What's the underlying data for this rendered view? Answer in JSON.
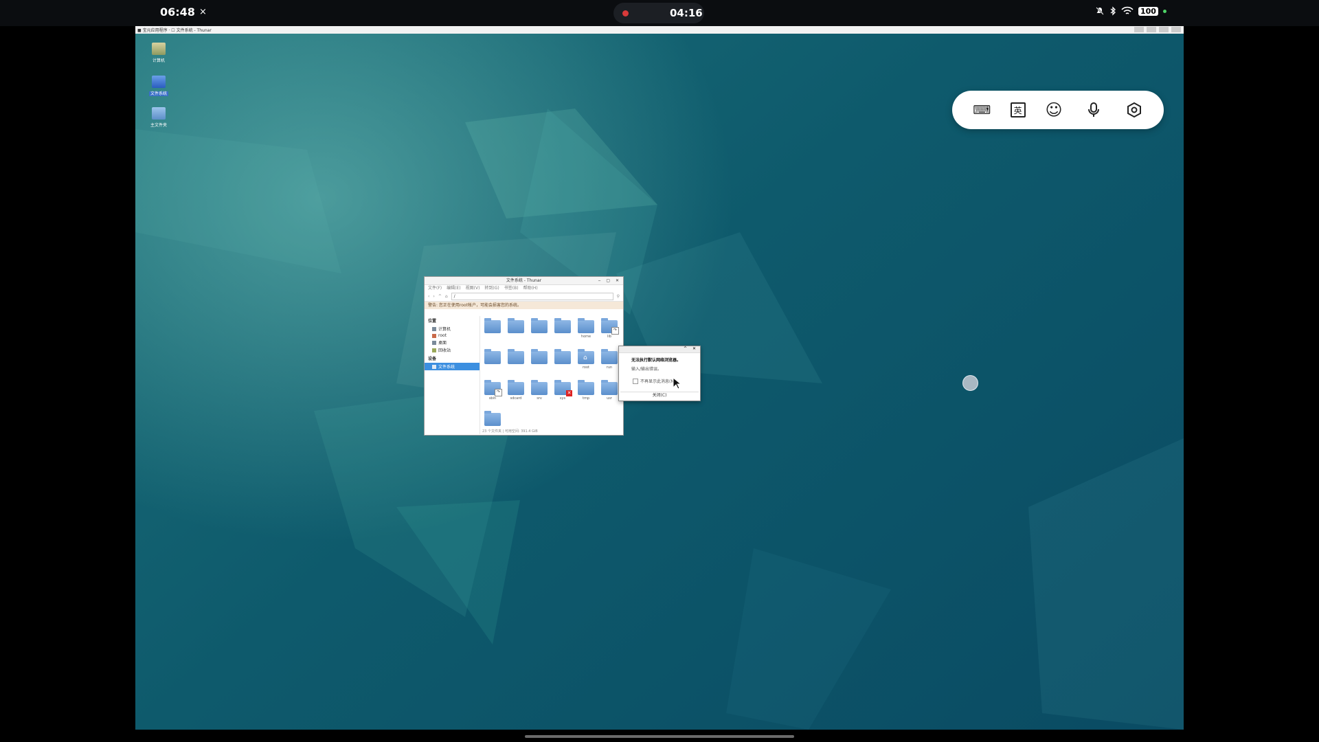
{
  "status_bar": {
    "time": "06:48",
    "close_glyph": "×",
    "recording_time": "04:16",
    "battery": "100",
    "icons": [
      "bell-muted-icon",
      "bluetooth-icon",
      "wifi-icon"
    ]
  },
  "remote_topbar": {
    "title": "■ 宝元应用程序 · ☐ 文件系统 - Thunar"
  },
  "desktop_icons": [
    {
      "label": "计算机",
      "icon": "computer-icon"
    },
    {
      "label": "文件系统",
      "icon": "drive-icon"
    },
    {
      "label": "主文件夹",
      "icon": "home-folder-icon"
    }
  ],
  "ime_toolbar": {
    "buttons": [
      {
        "name": "keyboard-icon",
        "glyph": "⌨"
      },
      {
        "name": "language-icon",
        "glyph": "英"
      },
      {
        "name": "emoji-icon",
        "glyph": "☺"
      },
      {
        "name": "microphone-icon",
        "glyph": "🎙"
      },
      {
        "name": "settings-icon",
        "glyph": "⬡"
      }
    ]
  },
  "file_manager": {
    "title": "文件系统 - Thunar",
    "window_controls": "‒ ▢ ✕",
    "menu": [
      "文件(F)",
      "编辑(E)",
      "视图(V)",
      "转到(G)",
      "书签(B)",
      "帮助(H)"
    ],
    "path": "/",
    "warning": "警告: 您正在使用root帐户，可能会损害您的系统。",
    "sidebar": {
      "places_header": "位置",
      "places": [
        "计算机",
        "root",
        "桌面",
        "回收站"
      ],
      "devices_header": "设备",
      "devices_selected": "文件系统"
    },
    "folders": [
      {
        "name": "",
        "badge": ""
      },
      {
        "name": "",
        "badge": ""
      },
      {
        "name": "",
        "badge": ""
      },
      {
        "name": "",
        "badge": ""
      },
      {
        "name": "home",
        "badge": ""
      },
      {
        "name": "lib",
        "badge": "link"
      },
      {
        "name": "",
        "badge": ""
      },
      {
        "name": "",
        "badge": ""
      },
      {
        "name": "",
        "badge": ""
      },
      {
        "name": "",
        "badge": ""
      },
      {
        "name": "root",
        "badge": "home"
      },
      {
        "name": "run",
        "badge": ""
      },
      {
        "name": "sbin",
        "badge": "link"
      },
      {
        "name": "sdcard",
        "badge": ""
      },
      {
        "name": "srv",
        "badge": ""
      },
      {
        "name": "sys",
        "badge": "x"
      },
      {
        "name": "tmp",
        "badge": ""
      },
      {
        "name": "usr",
        "badge": ""
      },
      {
        "name": "",
        "badge": ""
      }
    ],
    "status": "23 个文件夹 | 可用空间: 391.4 GiB"
  },
  "dialog": {
    "message": "无法执行默认网络浏览器。",
    "sub": "输入/输出错误。",
    "checkbox": "不再显示此消息(N)",
    "button": "关闭(C)"
  }
}
